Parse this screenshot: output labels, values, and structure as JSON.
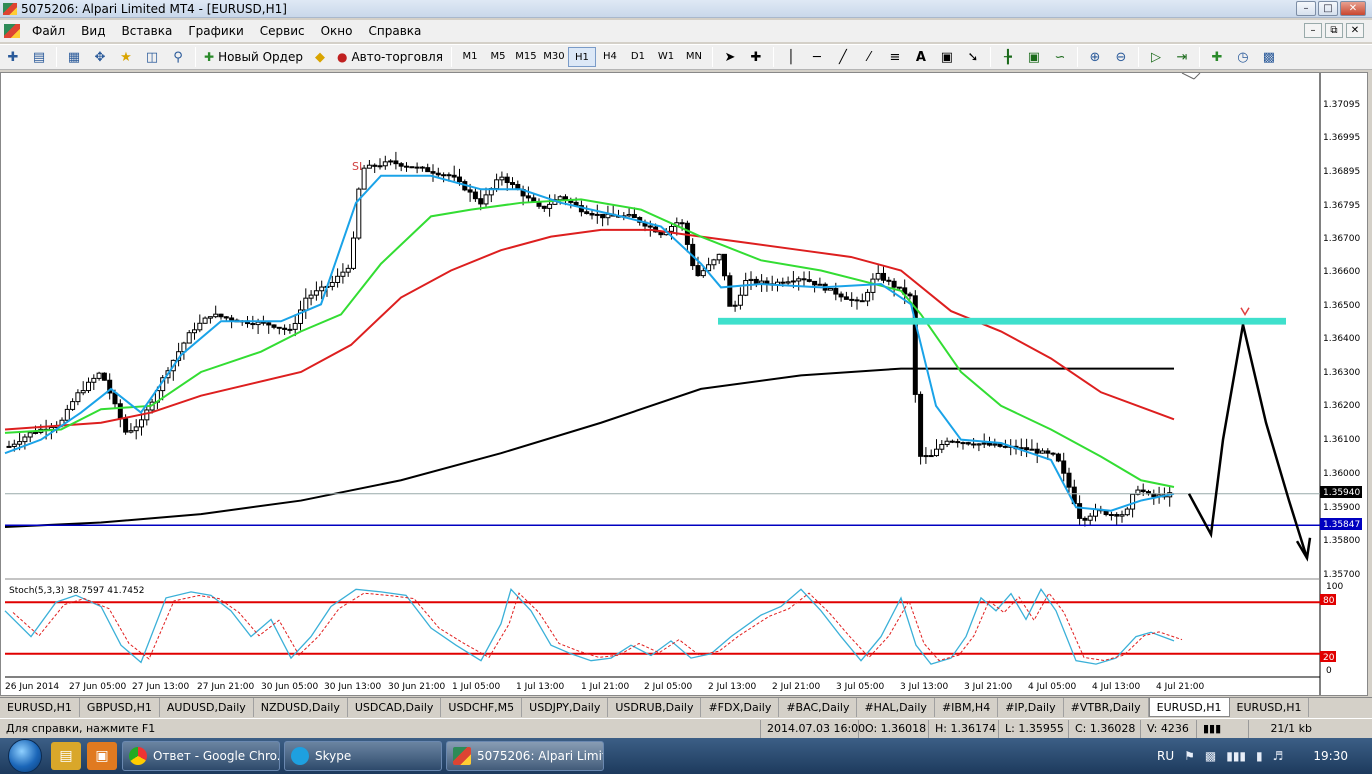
{
  "window": {
    "title": "5075206: Alpari Limited MT4 - [EURUSD,H1]"
  },
  "menu": [
    "Файл",
    "Вид",
    "Вставка",
    "Графики",
    "Сервис",
    "Окно",
    "Справка"
  ],
  "toolbar": {
    "new_order": "Новый Ордер",
    "auto_trading": "Авто-торговля",
    "timeframes": [
      "M1",
      "M5",
      "M15",
      "M30",
      "H1",
      "H4",
      "D1",
      "W1",
      "MN"
    ],
    "active_timeframe": "H1"
  },
  "chart": {
    "symbol": "EURUSD,H1",
    "indicator_label": "Stoch(5,3,3) 38.7597 41.7452",
    "sl_label": "SL",
    "price_ticks": [
      "1.37095",
      "1.36995",
      "1.36895",
      "1.36795",
      "1.36700",
      "1.36600",
      "1.36500",
      "1.36400",
      "1.36300",
      "1.36200",
      "1.36100",
      "1.36000",
      "1.35900",
      "1.35800",
      "1.35700"
    ],
    "current_price": "1.35940",
    "line_price": "1.35847",
    "stoch_ticks": [
      "100",
      "80",
      "20",
      "0"
    ],
    "time_labels": [
      "26 Jun 2014",
      "27 Jun 05:00",
      "27 Jun 13:00",
      "27 Jun 21:00",
      "30 Jun 05:00",
      "30 Jun 13:00",
      "30 Jun 21:00",
      "1 Jul 05:00",
      "1 Jul 13:00",
      "1 Jul 21:00",
      "2 Jul 05:00",
      "2 Jul 13:00",
      "2 Jul 21:00",
      "3 Jul 05:00",
      "3 Jul 13:00",
      "3 Jul 21:00",
      "4 Jul 05:00",
      "4 Jul 13:00",
      "4 Jul 21:00"
    ],
    "colors": {
      "bg": "#ffffff",
      "candle": "#000000",
      "ma_fast": "#1aa3e8",
      "ma_mid": "#33dd33",
      "ma_slow": "#dd1f1f",
      "ma_long": "#000000",
      "zone": "#3fe0cc",
      "hline": "#0000c0",
      "stoch_main": "#3bb0d8",
      "stoch_signal": "#e02020",
      "level": "#e00000"
    }
  },
  "symbol_tabs": [
    "EURUSD,H1",
    "GBPUSD,H1",
    "AUDUSD,Daily",
    "NZDUSD,Daily",
    "USDCAD,Daily",
    "USDCHF,M5",
    "USDJPY,Daily",
    "USDRUB,Daily",
    "#FDX,Daily",
    "#BAC,Daily",
    "#HAL,Daily",
    "#IBM,H4",
    "#IP,Daily",
    "#VTBR,Daily",
    "EURUSD,H1",
    "EURUSD,H1"
  ],
  "active_symbol_tab": 14,
  "status": {
    "help": "Для справки, нажмите F1",
    "datetime": "2014.07.03 16:00",
    "open": "O: 1.36018",
    "high": "H: 1.36174",
    "low": "L: 1.35955",
    "close": "C: 1.36028",
    "volume": "V: 4236",
    "traffic": "21/1 kb"
  },
  "taskbar": {
    "buttons": [
      "Ответ - Google Chro...",
      "Skype",
      "5075206: Alpari Limit..."
    ],
    "lang": "RU",
    "clock": "19:30"
  }
}
